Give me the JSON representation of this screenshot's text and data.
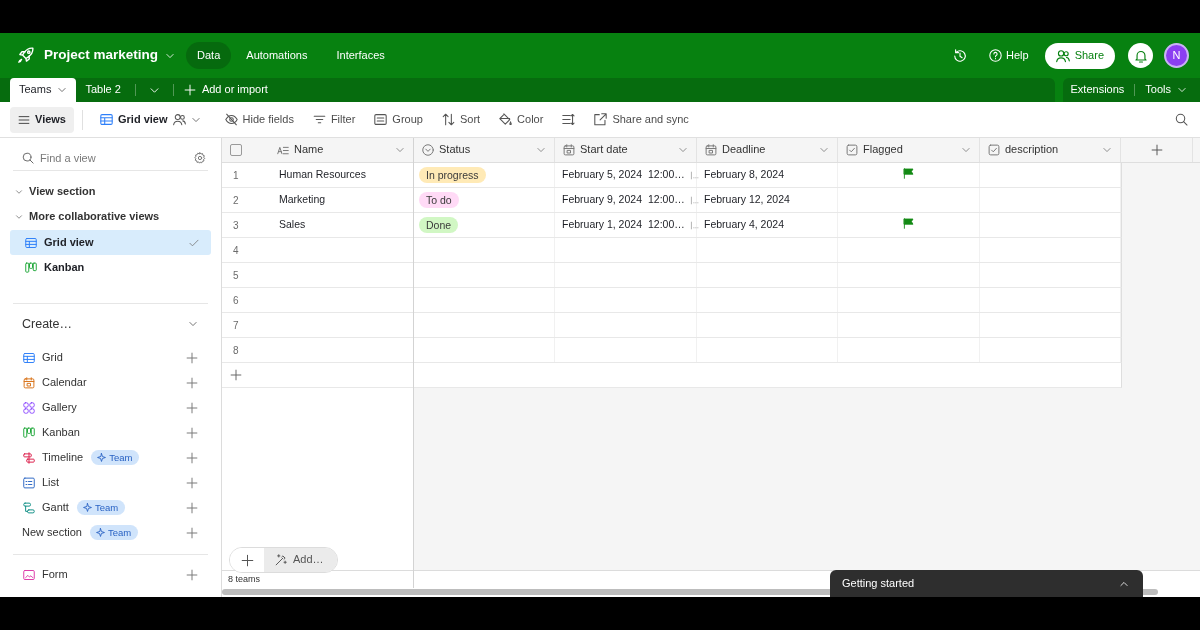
{
  "app_bar": {
    "base_name": "Project marketing",
    "nav": [
      {
        "label": "Data",
        "selected": true
      },
      {
        "label": "Automations",
        "selected": false
      },
      {
        "label": "Interfaces",
        "selected": false
      }
    ],
    "help": "Help",
    "share": "Share",
    "avatar": "N"
  },
  "table_tabs": [
    {
      "label": "Teams",
      "selected": true
    },
    {
      "label": "Table 2",
      "selected": false
    }
  ],
  "add_table": "Add or import",
  "extensions": "Extensions",
  "tools": "Tools",
  "toolbar": {
    "views": "Views",
    "view_name": "Grid view",
    "items": [
      {
        "kind": "hide_fields",
        "label": "Hide fields"
      },
      {
        "kind": "filter",
        "label": "Filter"
      },
      {
        "kind": "group",
        "label": "Group"
      },
      {
        "kind": "sort",
        "label": "Sort"
      },
      {
        "kind": "color",
        "label": "Color"
      },
      {
        "kind": "row_height"
      },
      {
        "kind": "share",
        "label": "Share and sync"
      }
    ]
  },
  "sidebar": {
    "search": {
      "placeholder": "Find a view"
    },
    "sections": [
      {
        "label": "View section",
        "expanded": true
      },
      {
        "label": "More collaborative views",
        "expanded": true,
        "views": [
          {
            "kind": "grid",
            "label": "Grid view",
            "selected": true
          },
          {
            "kind": "kanban",
            "label": "Kanban",
            "selected": false
          }
        ]
      }
    ],
    "create": {
      "label": "Create…",
      "expanded": true,
      "items": [
        {
          "kind": "grid",
          "label": "Grid"
        },
        {
          "kind": "calendar",
          "label": "Calendar"
        },
        {
          "kind": "gallery",
          "label": "Gallery"
        },
        {
          "kind": "kanban",
          "label": "Kanban"
        },
        {
          "kind": "timeline",
          "label": "Timeline",
          "badge": "Team"
        },
        {
          "kind": "list",
          "label": "List"
        },
        {
          "kind": "gantt",
          "label": "Gantt",
          "badge": "Team"
        },
        {
          "kind": "section",
          "label": "New section",
          "badge": "Team"
        }
      ]
    },
    "extra_items": [
      {
        "kind": "form",
        "label": "Form"
      }
    ]
  },
  "grid": {
    "select_all": {
      "checked": false
    },
    "columns": [
      {
        "kind": "text",
        "label": "Name"
      },
      {
        "kind": "single_select",
        "label": "Status"
      },
      {
        "kind": "date",
        "label": "Start date"
      },
      {
        "kind": "date",
        "label": "Deadline"
      },
      {
        "kind": "checkbox",
        "label": "Flagged"
      },
      {
        "kind": "checkbox",
        "label": "description"
      }
    ],
    "rows": [
      {
        "number": "1",
        "name": "Human Resources",
        "status": {
          "label": "In progress",
          "color": "#ffeab6"
        },
        "start_date": "February 5, 2024",
        "start_time": "12:00…",
        "deadline": "February 8, 2024",
        "flagged": true
      },
      {
        "number": "2",
        "name": "Marketing",
        "status": {
          "label": "To do",
          "color": "#ffdaf6"
        },
        "start_date": "February 9, 2024",
        "start_time": "12:00…",
        "deadline": "February 12, 2024",
        "flagged": false
      },
      {
        "number": "3",
        "name": "Sales",
        "status": {
          "label": "Done",
          "color": "#d1f7c4"
        },
        "start_date": "February 1, 2024",
        "start_time": "12:00…",
        "deadline": "February 4, 2024",
        "flagged": true
      },
      {
        "number": "4",
        "flagged": false
      },
      {
        "number": "5",
        "flagged": false
      },
      {
        "number": "6",
        "flagged": false
      },
      {
        "number": "7",
        "flagged": false
      },
      {
        "number": "8",
        "flagged": false
      }
    ],
    "add_button": "Add…",
    "record_count": "8 teams"
  },
  "toast": {
    "label": "Getting started"
  }
}
